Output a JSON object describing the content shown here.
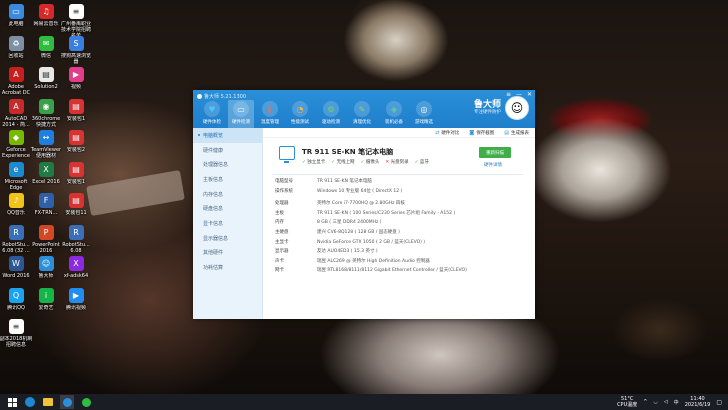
{
  "desktop": {
    "icons": [
      {
        "label": "此电脑",
        "color": "#3a8be0",
        "glyph": "▭"
      },
      {
        "label": "网易云音乐",
        "color": "#d62828",
        "glyph": "♫"
      },
      {
        "label": "广州番禺职业技术学院招聘名单",
        "color": "#ffffff",
        "glyph": "≡"
      },
      {
        "label": "回收站",
        "color": "#7d8fa5",
        "glyph": "♻"
      },
      {
        "label": "微信",
        "color": "#2ebd3e",
        "glyph": "✉"
      },
      {
        "label": "搜狗高速浏览器",
        "color": "#3a7fe0",
        "glyph": "S"
      },
      {
        "label": "Adobe Acrobat DC",
        "color": "#c81e1e",
        "glyph": "A"
      },
      {
        "label": "Solution2",
        "color": "#e8e8e8",
        "glyph": "▤"
      },
      {
        "label": "视频",
        "color": "#e23c8a",
        "glyph": "▶"
      },
      {
        "label": "AutoCAD 2014 - 简...",
        "color": "#c62a2a",
        "glyph": "A"
      },
      {
        "label": "360chrome 快捷方式",
        "color": "#3aa14b",
        "glyph": "◉"
      },
      {
        "label": "安装包1",
        "color": "#d83232",
        "glyph": "▤"
      },
      {
        "label": "Geforce Experience",
        "color": "#76b900",
        "glyph": "◆"
      },
      {
        "label": "TeamViewer 便用器材",
        "color": "#1f7fe0",
        "glyph": "↔"
      },
      {
        "label": "安装包2",
        "color": "#d83232",
        "glyph": "▤"
      },
      {
        "label": "Microsoft Edge",
        "color": "#1b8ad0",
        "glyph": "e"
      },
      {
        "label": "Excel 2016",
        "color": "#1f7a44",
        "glyph": "X"
      },
      {
        "label": "安装包1",
        "color": "#d83232",
        "glyph": "▤"
      },
      {
        "label": "QQ音乐",
        "color": "#f0c419",
        "glyph": "♪"
      },
      {
        "label": "FX-TRN...",
        "color": "#2f5fa8",
        "glyph": "F"
      },
      {
        "label": "安装包11",
        "color": "#d83232",
        "glyph": "▤"
      },
      {
        "label": "RobotStu... 6.08 (32 ...",
        "color": "#3a6fb8",
        "glyph": "R"
      },
      {
        "label": "PowerPoint 2016",
        "color": "#d24726",
        "glyph": "P"
      },
      {
        "label": "RobotStu... 6.08",
        "color": "#3a6fb8",
        "glyph": "R"
      },
      {
        "label": "Word 2016",
        "color": "#2b5797",
        "glyph": "W"
      },
      {
        "label": "鲁大师",
        "color": "#2a8fd8",
        "glyph": "☺"
      },
      {
        "label": "xf-adsk64",
        "color": "#8a2be2",
        "glyph": "X"
      },
      {
        "label": "腾讯QQ",
        "color": "#1aa3f0",
        "glyph": "Q"
      },
      {
        "label": "爱奇艺",
        "color": "#16b54a",
        "glyph": "i"
      },
      {
        "label": "腾讯视频",
        "color": "#1f8ef0",
        "glyph": "▶"
      },
      {
        "label": "副本2018机制招聘信息",
        "color": "#ffffff",
        "glyph": "≡"
      }
    ]
  },
  "window": {
    "title": "鲁大师 5.21.1300",
    "controls": {
      "menu": "≡",
      "minimize": "—",
      "close": "✕"
    },
    "toolbar": [
      {
        "label": "硬件体检",
        "icon": "heart-monitor-icon",
        "color": "#4cc3ff",
        "glyph": "♥"
      },
      {
        "label": "硬件检测",
        "icon": "computer-icon",
        "color": "#ffffff",
        "glyph": "▭"
      },
      {
        "label": "温度管理",
        "icon": "thermometer-icon",
        "color": "#ff6a4a",
        "glyph": "🌡"
      },
      {
        "label": "性能测试",
        "icon": "speedometer-icon",
        "color": "#ffb83b",
        "glyph": "◔"
      },
      {
        "label": "驱动检测",
        "icon": "driver-icon",
        "color": "#7bd15c",
        "glyph": "⚙"
      },
      {
        "label": "清理优化",
        "icon": "broom-icon",
        "color": "#8ed068",
        "glyph": "✎"
      },
      {
        "label": "装机必备",
        "icon": "box-icon",
        "color": "#5bd19b",
        "glyph": "◈"
      },
      {
        "label": "游戏精选",
        "icon": "gamepad-icon",
        "color": "#ffffff",
        "glyph": "◎"
      }
    ],
    "brand": {
      "name": "鲁大师",
      "subtitle": "专注硬件防护"
    },
    "sidebar": [
      "电脑概览",
      "硬件健康",
      "处理器信息",
      "主板信息",
      "内存信息",
      "硬盘信息",
      "显卡信息",
      "显示器信息",
      "其他硬件",
      "功耗估算"
    ],
    "actions": [
      {
        "label": "硬件对比",
        "icon": "compare-icon"
      },
      {
        "label": "保存截图",
        "icon": "camera-icon"
      },
      {
        "label": "生成报表",
        "icon": "report-icon"
      }
    ],
    "summary": {
      "pc_name": "TR 911 SE-KN 笔记本电脑",
      "badges": [
        {
          "label": "独立显卡",
          "ok": true
        },
        {
          "label": "无线上网",
          "ok": true
        },
        {
          "label": "摄像头",
          "ok": true
        },
        {
          "label": "光盘刻录",
          "ok": false
        },
        {
          "label": "蓝牙",
          "ok": true
        }
      ],
      "detect_button": "重新扫描",
      "detail_link": "硬件详情"
    },
    "specs": [
      {
        "key": "电脑型号",
        "value": "TR 911 SE-KN 笔记本电脑"
      },
      {
        "key": "操作系统",
        "value": "Windows 10 专业版 64位 ( DirectX 12 )"
      },
      {
        "key": "处理器",
        "value": "英特尔 Core i7-7700HQ @ 2.80GHz 四核"
      },
      {
        "key": "主板",
        "value": "TR 911 SE-KN ( 100 Series/C230 Series 芯片组 Family - A152 )"
      },
      {
        "key": "内存",
        "value": "8 GB ( 三星 DDR4 2400MHz )"
      },
      {
        "key": "主硬盘",
        "value": "建兴 CV6-8Q128 ( 128 GB / 固态硬盘 )"
      },
      {
        "key": "主显卡",
        "value": "Nvidia GeForce GTX 1050 ( 2 GB / 蓝天(CLEVO) )"
      },
      {
        "key": "显示器",
        "value": "友达 AUO4ED3 ( 15.3 英寸 )"
      },
      {
        "key": "声卡",
        "value": "瑞昱 ALC269 @ 英特尔 High Definition Audio 控制器"
      },
      {
        "key": "网卡",
        "value": "瑞昱 RTL8168/8111/8112 Gigabit Ethernet Controller / 蓝天(CLEVO)"
      }
    ]
  },
  "taskbar": {
    "weather_temp": "51°C",
    "weather_label": "CPU温度",
    "time": "11:40",
    "date": "2021/6/19"
  }
}
